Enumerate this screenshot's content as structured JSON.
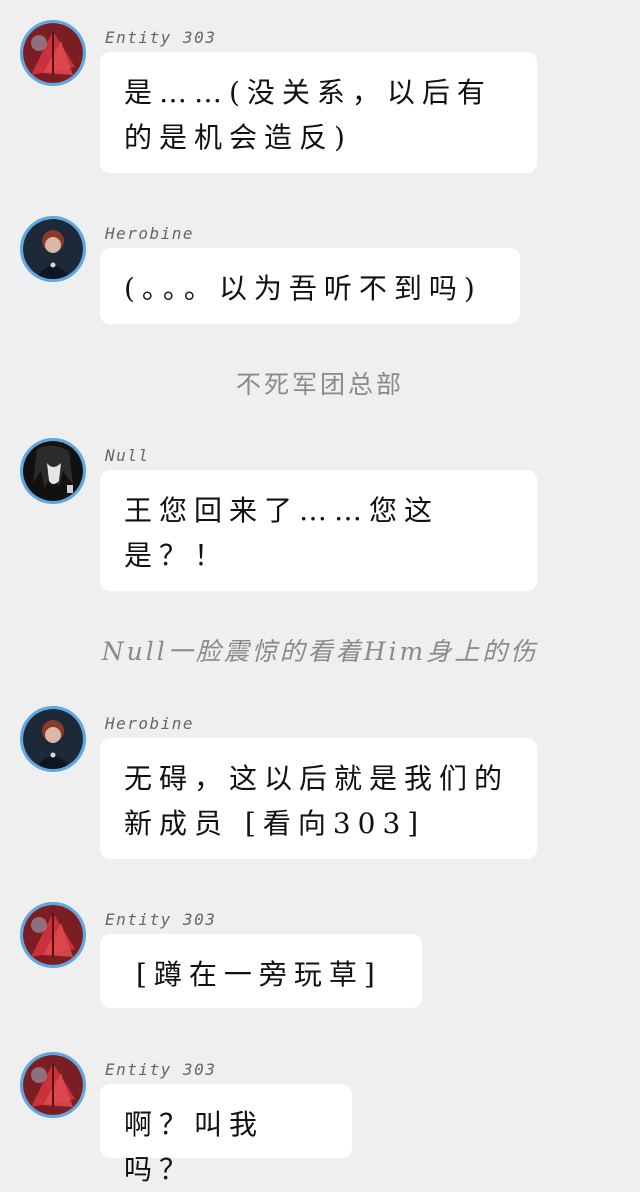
{
  "messages": [
    {
      "name": "Entity 303",
      "text": "是……(没关系，以后有的是机会造反)"
    },
    {
      "name": "Herobine",
      "text": "(。。。以为吾听不到吗)"
    },
    {
      "name": "Null",
      "text": "王您回来了……您这是？！"
    },
    {
      "name": "Herobine",
      "text": "无碍，这以后就是我们的新成员 [看向303]"
    },
    {
      "name": "Entity 303",
      "text": "[蹲在一旁玩草]"
    },
    {
      "name": "Entity 303",
      "text": "啊？叫我吗？"
    }
  ],
  "narrations": [
    "不死军团总部",
    "Null一脸震惊的看着Him身上的伤"
  ],
  "avatars": {
    "entity303": "red-leaf-avatar",
    "herobine": "dark-figure-avatar",
    "null": "black-hair-avatar"
  },
  "colors": {
    "background": "#efefef",
    "bubble": "#ffffff",
    "avatar_ring": "#5aa9e6",
    "narration": "#8a8a8a"
  }
}
